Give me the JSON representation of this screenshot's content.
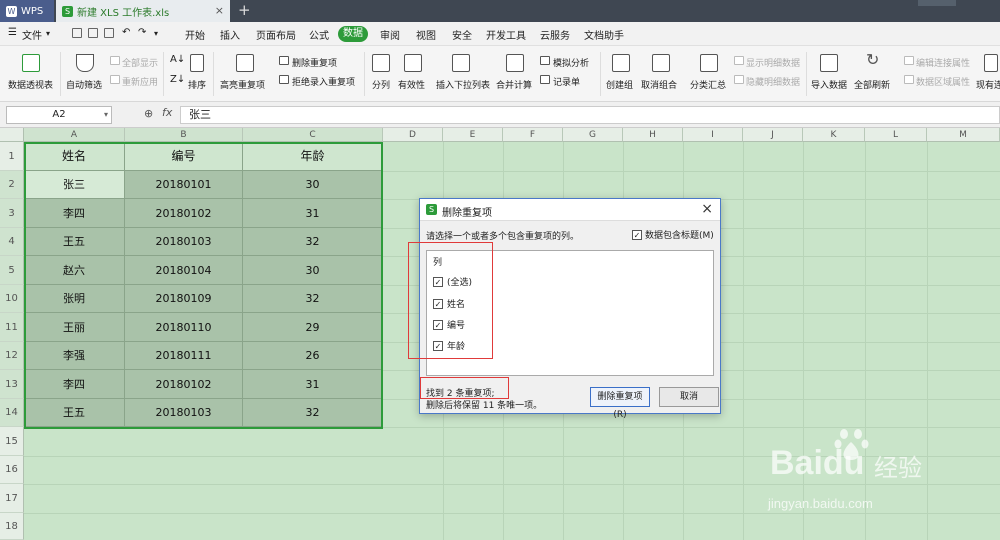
{
  "titlebar": {
    "app_label": "WPS",
    "doc_tab": "新建 XLS 工作表.xls"
  },
  "menubar": {
    "file_label": "文件",
    "items": [
      "开始",
      "插入",
      "页面布局",
      "公式",
      "数据",
      "审阅",
      "视图",
      "安全",
      "开发工具",
      "云服务",
      "文档助手"
    ],
    "active": "数据"
  },
  "ribbon": {
    "pivot": "数据透视表",
    "autofilter": "自动筛选",
    "show_all": "全部显示",
    "reapply": "重新应用",
    "sort": "排序",
    "highlight_dup": "高亮重复项",
    "delete_dup": "删除重复项",
    "reject_dup": "拒绝录入重复项",
    "split": "分列",
    "validity": "有效性",
    "dropdown": "插入下拉列表",
    "consolidate": "合并计算",
    "whatif": "模拟分析",
    "record": "记录单",
    "group": "创建组",
    "ungroup": "取消组合",
    "subtotal": "分类汇总",
    "show_detail": "显示明细数据",
    "hide_detail": "隐藏明细数据",
    "import": "导入数据",
    "refresh": "全部刷新",
    "edit_links": "编辑连接属性",
    "range_props": "数据区域属性",
    "existing": "现有连"
  },
  "formulabar": {
    "cell_ref": "A2",
    "fx_label": "fx",
    "value": "张三"
  },
  "sheet": {
    "columns": [
      "A",
      "B",
      "C",
      "D",
      "E",
      "F",
      "G",
      "H",
      "I",
      "J",
      "K",
      "L",
      "M"
    ],
    "row_numbers": [
      "1",
      "2",
      "3",
      "4",
      "5",
      "10",
      "11",
      "12",
      "13",
      "14",
      "15",
      "16",
      "17",
      "18"
    ],
    "headers": [
      "姓名",
      "编号",
      "年龄"
    ],
    "rows": [
      [
        "张三",
        "20180101",
        "30"
      ],
      [
        "李四",
        "20180102",
        "31"
      ],
      [
        "王五",
        "20180103",
        "32"
      ],
      [
        "赵六",
        "20180104",
        "30"
      ],
      [
        "张明",
        "20180109",
        "32"
      ],
      [
        "王丽",
        "20180110",
        "29"
      ],
      [
        "李强",
        "20180111",
        "26"
      ],
      [
        "李四",
        "20180102",
        "31"
      ],
      [
        "王五",
        "20180103",
        "32"
      ]
    ]
  },
  "dialog": {
    "title": "删除重复项",
    "prompt": "请选择一个或者多个包含重复项的列。",
    "header_checkbox": "数据包含标题(M)",
    "list_header": "列",
    "items": [
      "(全选)",
      "姓名",
      "编号",
      "年龄"
    ],
    "found": "找到 2 条重复项;",
    "remain": "删除后将保留 11 条唯一项。",
    "delete_button": "删除重复项(R)",
    "cancel_button": "取消"
  },
  "watermark": {
    "brand": "Baidu",
    "brand_cn": "经验",
    "url": "jingyan.baidu.com"
  },
  "colors": {
    "accent": "#2d9b3a",
    "sheet_bg": "#c9e4c9",
    "highlight_red": "#e03a3a",
    "dialog_border": "#4a78c8"
  }
}
